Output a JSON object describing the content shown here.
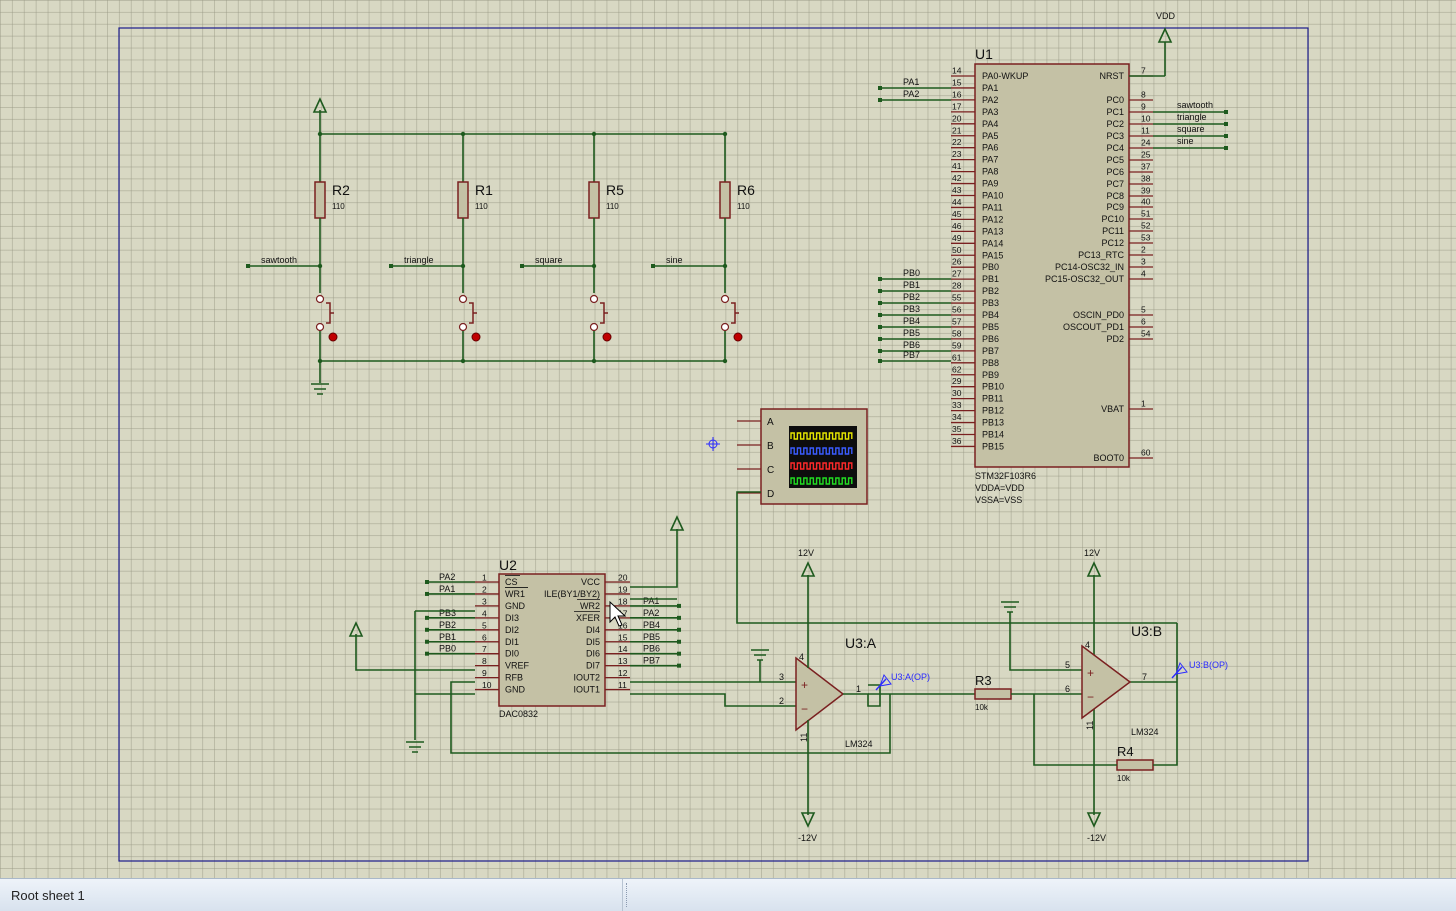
{
  "status_bar": {
    "sheet": "Root sheet 1"
  },
  "power": {
    "vdd": "VDD",
    "plus12": "12V",
    "minus12": "-12V"
  },
  "resistors": [
    {
      "ref": "R2",
      "value": "110"
    },
    {
      "ref": "R1",
      "value": "110"
    },
    {
      "ref": "R5",
      "value": "110"
    },
    {
      "ref": "R6",
      "value": "110"
    },
    {
      "ref": "R3",
      "value": "10k"
    },
    {
      "ref": "R4",
      "value": "10k"
    }
  ],
  "switch_nets": [
    "sawtooth",
    "triangle",
    "square",
    "sine"
  ],
  "u1": {
    "ref": "U1",
    "part": "STM32F103R6",
    "notes": [
      "VDDA=VDD",
      "VSSA=VSS"
    ],
    "left_pins": [
      [
        "14",
        "PA0-WKUP"
      ],
      [
        "15",
        "PA1"
      ],
      [
        "16",
        "PA2"
      ],
      [
        "17",
        "PA3"
      ],
      [
        "20",
        "PA4"
      ],
      [
        "21",
        "PA5"
      ],
      [
        "22",
        "PA6"
      ],
      [
        "23",
        "PA7"
      ],
      [
        "41",
        "PA8"
      ],
      [
        "42",
        "PA9"
      ],
      [
        "43",
        "PA10"
      ],
      [
        "44",
        "PA11"
      ],
      [
        "45",
        "PA12"
      ],
      [
        "46",
        "PA13"
      ],
      [
        "49",
        "PA14"
      ],
      [
        "50",
        "PA15"
      ],
      [
        "26",
        "PB0"
      ],
      [
        "27",
        "PB1"
      ],
      [
        "28",
        "PB2"
      ],
      [
        "55",
        "PB3"
      ],
      [
        "56",
        "PB4"
      ],
      [
        "57",
        "PB5"
      ],
      [
        "58",
        "PB6"
      ],
      [
        "59",
        "PB7"
      ],
      [
        "61",
        "PB8"
      ],
      [
        "62",
        "PB9"
      ],
      [
        "29",
        "PB10"
      ],
      [
        "30",
        "PB11"
      ],
      [
        "33",
        "PB12"
      ],
      [
        "34",
        "PB13"
      ],
      [
        "35",
        "PB14"
      ],
      [
        "36",
        "PB15"
      ]
    ],
    "right_pins": [
      [
        "7",
        "NRST"
      ],
      [
        "8",
        "PC0"
      ],
      [
        "9",
        "PC1"
      ],
      [
        "10",
        "PC2"
      ],
      [
        "11",
        "PC3"
      ],
      [
        "24",
        "PC4"
      ],
      [
        "25",
        "PC5"
      ],
      [
        "37",
        "PC6"
      ],
      [
        "38",
        "PC7"
      ],
      [
        "39",
        "PC8"
      ],
      [
        "40",
        "PC9"
      ],
      [
        "51",
        "PC10"
      ],
      [
        "52",
        "PC11"
      ],
      [
        "53",
        "PC12"
      ],
      [
        "2",
        "PC13_RTC"
      ],
      [
        "3",
        "PC14-OSC32_IN"
      ],
      [
        "4",
        "PC15-OSC32_OUT"
      ],
      [
        "5",
        "OSCIN_PD0"
      ],
      [
        "6",
        "OSCOUT_PD1"
      ],
      [
        "54",
        "PD2"
      ],
      [
        "1",
        "VBAT"
      ],
      [
        "60",
        "BOOT0"
      ]
    ],
    "left_nets": [
      "PA1",
      "PA2",
      "PB0",
      "PB1",
      "PB2",
      "PB3",
      "PB4",
      "PB5",
      "PB6",
      "PB7"
    ],
    "right_nets": [
      "sawtooth",
      "triangle",
      "square",
      "sine"
    ]
  },
  "u2": {
    "ref": "U2",
    "part": "DAC0832",
    "left_pins": [
      [
        "1",
        "CS"
      ],
      [
        "2",
        "WR1"
      ],
      [
        "3",
        "GND"
      ],
      [
        "4",
        "DI3"
      ],
      [
        "5",
        "DI2"
      ],
      [
        "6",
        "DI1"
      ],
      [
        "7",
        "DI0"
      ],
      [
        "8",
        "VREF"
      ],
      [
        "9",
        "RFB"
      ],
      [
        "10",
        "GND"
      ]
    ],
    "right_pins": [
      [
        "20",
        "VCC"
      ],
      [
        "19",
        "ILE(BY1/BY2)"
      ],
      [
        "18",
        "WR2"
      ],
      [
        "17",
        "XFER"
      ],
      [
        "16",
        "DI4"
      ],
      [
        "15",
        "DI5"
      ],
      [
        "14",
        "DI6"
      ],
      [
        "13",
        "DI7"
      ],
      [
        "12",
        "IOUT2"
      ],
      [
        "11",
        "IOUT1"
      ]
    ],
    "left_nets": [
      "PA2",
      "PA1",
      "",
      "PB3",
      "PB2",
      "PB1",
      "PB0"
    ],
    "right_nets": [
      "",
      "",
      "PA1",
      "PA2",
      "PB4",
      "PB5",
      "PB6",
      "PB7"
    ]
  },
  "u3a": {
    "ref": "U3:A",
    "part": "LM324",
    "probe": "U3:A(OP)",
    "pins": [
      "3",
      "2",
      "1",
      "4",
      "11"
    ]
  },
  "u3b": {
    "ref": "U3:B",
    "part": "LM324",
    "probe": "U3:B(OP)",
    "pins": [
      "5",
      "6",
      "7",
      "4",
      "11"
    ]
  },
  "scope": {
    "channels": [
      "A",
      "B",
      "C",
      "D"
    ],
    "colors": [
      "#e6e600",
      "#3a5cff",
      "#ff2a2a",
      "#22dd22"
    ]
  }
}
